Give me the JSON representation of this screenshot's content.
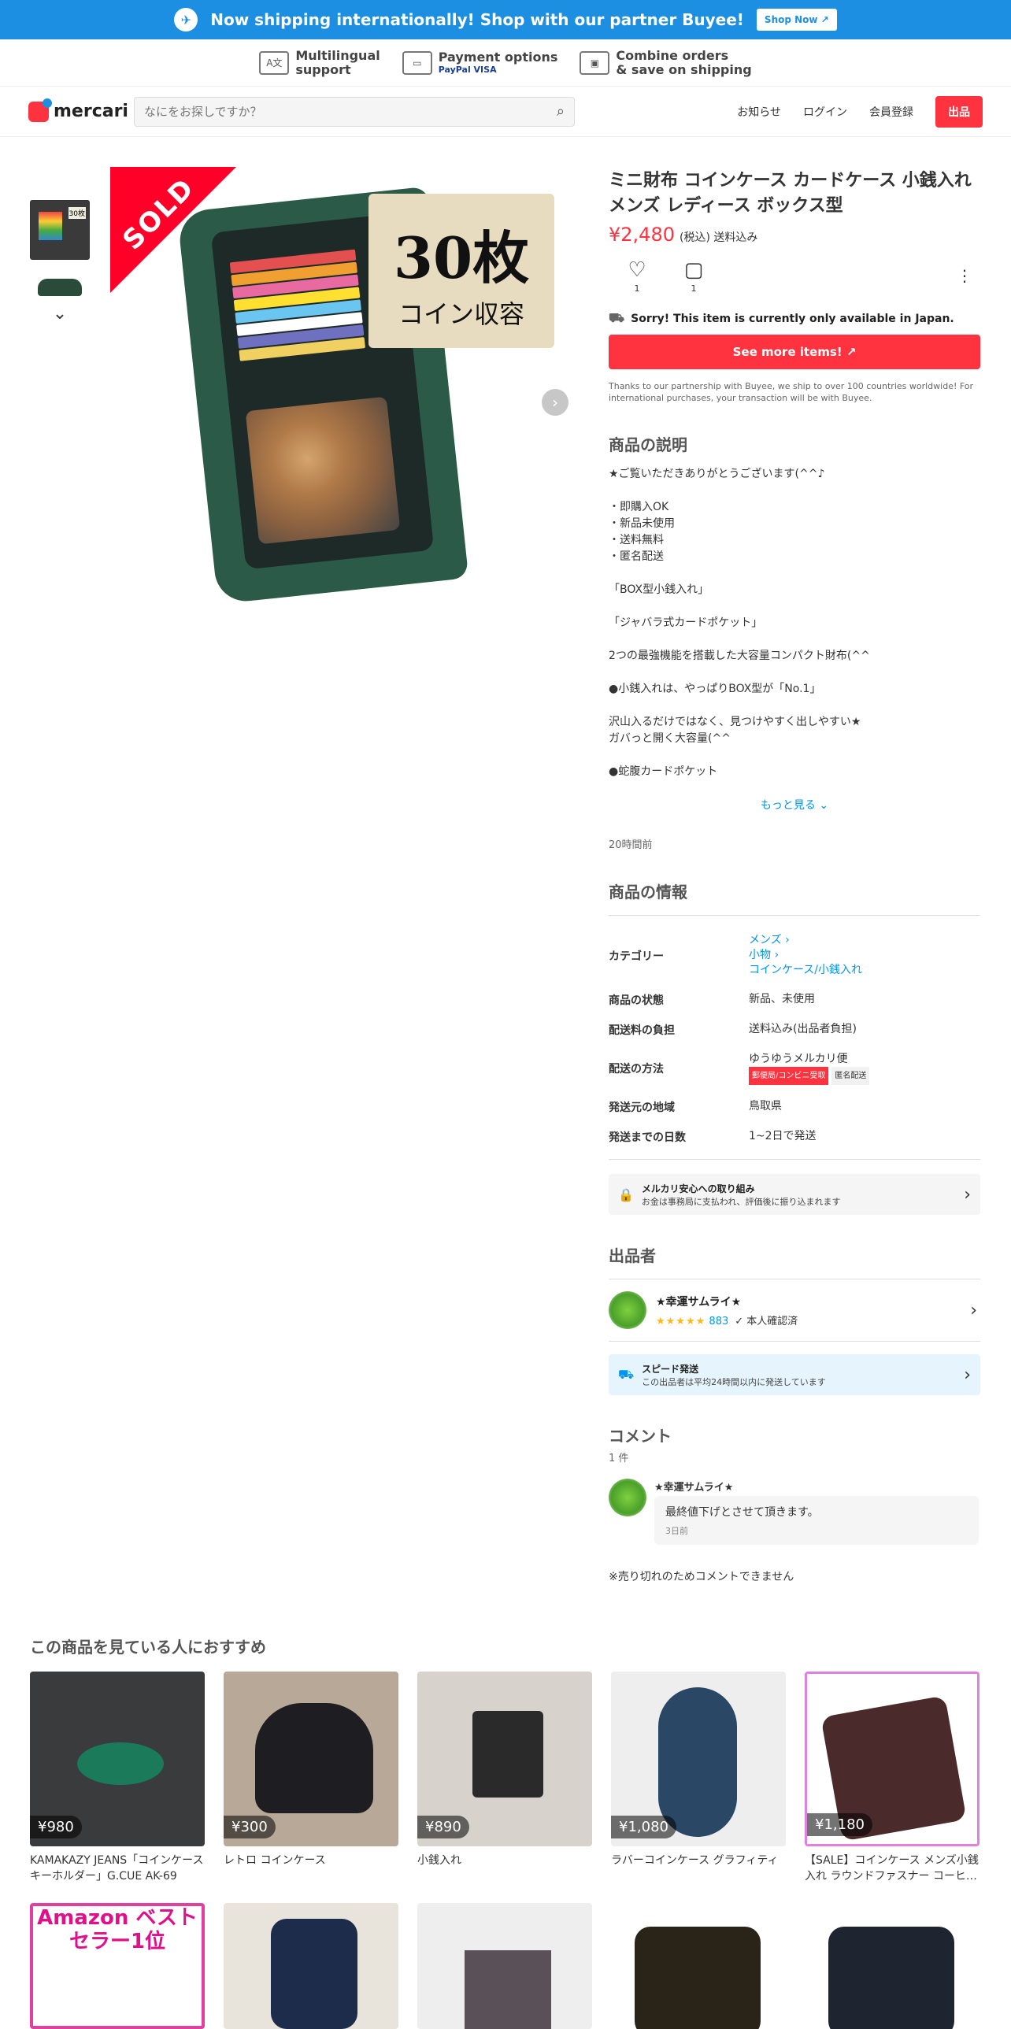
{
  "banner": {
    "text": "Now shipping internationally! Shop with our partner Buyee!",
    "button": "Shop Now"
  },
  "features": [
    {
      "title": "Multilingual",
      "sub": "support"
    },
    {
      "title": "Payment options",
      "sub": "PayPal VISA"
    },
    {
      "title": "Combine orders",
      "sub": "& save on shipping"
    }
  ],
  "header": {
    "logo": "mercari",
    "search_placeholder": "なにをお探しですか？",
    "nav": {
      "news": "お知らせ",
      "login": "ログイン",
      "signup": "会員登録",
      "sell": "出品"
    }
  },
  "gallery": {
    "sold": "SOLD",
    "label_big": "30枚",
    "label_small": "コイン収容"
  },
  "product": {
    "title": "ミニ財布 コインケース カードケース 小銭入れ メンズ レディース ボックス型",
    "price": "¥2,480",
    "tax": "(税込) 送料込み",
    "likes": "1",
    "comments": "1",
    "notice": "Sorry! This item is currently only available in Japan.",
    "see_more": "See more items!",
    "thanks": "Thanks to our partnership with Buyee, we ship to over 100 countries worldwide! For international purchases, your transaction will be with Buyee."
  },
  "description": {
    "heading": "商品の説明",
    "body": "★ご覧いただきありがとうございます(^^♪\n\n・即購入OK\n・新品未使用\n・送料無料\n・匿名配送\n\n「BOX型小銭入れ」\n\n「ジャバラ式カードポケット」\n\n2つの最強機能を搭載した大容量コンパクト財布(^^\n\n●小銭入れは、やっぱりBOX型が「No.1」\n\n沢山入るだけではなく、見つけやすく出しやすい★\nガバっと開く大容量(^^\n\n●蛇腹カードポケット",
    "more": "もっと見る",
    "ago": "20時間前"
  },
  "info": {
    "heading": "商品の情報",
    "category_label": "カテゴリー",
    "categories": [
      "メンズ",
      "小物",
      "コインケース/小銭入れ"
    ],
    "condition_label": "商品の状態",
    "condition": "新品、未使用",
    "shipping_fee_label": "配送料の負担",
    "shipping_fee": "送料込み(出品者負担)",
    "method_label": "配送の方法",
    "method": "ゆうゆうメルカリ便",
    "tag1": "郵便局/コンビニ受取",
    "tag2": "匿名配送",
    "origin_label": "発送元の地域",
    "origin": "鳥取県",
    "days_label": "発送までの日数",
    "days": "1~2日で発送"
  },
  "safe": {
    "title": "メルカリ安心への取り組み",
    "sub": "お金は事務局に支払われ、評価後に振り込まれます"
  },
  "seller": {
    "heading": "出品者",
    "name": "★幸運サムライ★",
    "stars": "★★★★★",
    "count": "883",
    "verified": "本人確認済"
  },
  "speed": {
    "title": "スピード発送",
    "sub": "この出品者は平均24時間以内に発送しています"
  },
  "comments": {
    "heading": "コメント",
    "count": "1 件",
    "author": "★幸運サムライ★",
    "text": "最終値下げとさせて頂きます。",
    "date": "3日前",
    "closed": "※売り切れのためコメントできません"
  },
  "recommend": {
    "heading": "この商品を見ている人におすすめ",
    "items": [
      {
        "price": "¥980",
        "name": "KAMAKAZY JEANS「コインケース キーホルダー」G.CUE AK-69",
        "color": "#3a3b3c"
      },
      {
        "price": "¥300",
        "name": "レトロ コインケース",
        "color": "#b8a898"
      },
      {
        "price": "¥890",
        "name": "小銭入れ",
        "color": "#d8d2cc"
      },
      {
        "price": "¥1,080",
        "name": "ラバーコインケース グラフィティ",
        "color": "#2a4766"
      },
      {
        "price": "¥1,180",
        "name": "【SALE】コインケース メンズ小銭入れ ラウンドファスナー コーヒ…",
        "color": "#4a2a2a"
      }
    ],
    "row2_label": "Amazon ベストセラー1位"
  }
}
